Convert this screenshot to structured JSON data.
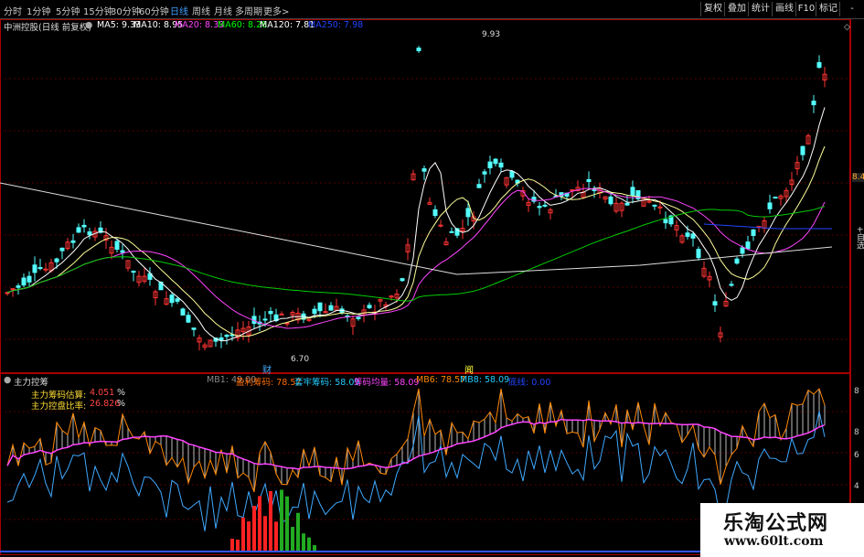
{
  "toolbar": {
    "periods": [
      "分时",
      "1分钟",
      "5分钟",
      "15分钟",
      "30分钟",
      "60分钟",
      "日线",
      "周线",
      "月线",
      "多周期",
      "更多>"
    ],
    "active_period": "日线",
    "buttons": [
      "复权",
      "叠加",
      "统计",
      "画线",
      "F10",
      "标记",
      "-"
    ]
  },
  "main": {
    "title": "中洲控股(日线 前复权)",
    "ma": [
      {
        "label": "MA5: 9.33",
        "color": "#ffffff"
      },
      {
        "label": "MA10: 8.95",
        "color": "#ffffff"
      },
      {
        "label": "MA20: 8.33",
        "color": "#ff44ff"
      },
      {
        "label": "MA60: 8.28",
        "color": "#00ff00"
      },
      {
        "label": "MA120: 7.81",
        "color": "#ffffff"
      },
      {
        "label": "MA250: 7.98",
        "color": "#2244ff"
      }
    ],
    "high_label": "9.93",
    "low_label": "6.70",
    "marker_cai": "财",
    "marker_wen": "闻",
    "price_tag": "8.49",
    "add_self": "+自选"
  },
  "indicator": {
    "title": "主力控筹",
    "items": [
      {
        "label": "MB1: 49.00",
        "color": "#888888"
      },
      {
        "label": "盈利筹码: 78.57",
        "color": "#ff6a00"
      },
      {
        "label": "套牢筹码: 58.09",
        "color": "#22ccff"
      },
      {
        "label": "筹码均量: 58.09",
        "color": "#ff44ff"
      },
      {
        "label": "MB6: 78.57",
        "color": "#ff8800"
      },
      {
        "label": "MB8: 58.09",
        "color": "#22ccff"
      },
      {
        "label": "底线: 0.00",
        "color": "#2244ff"
      }
    ],
    "estimate_label": "主力筹码估算:",
    "estimate_value": "4.051",
    "estimate_unit": "%",
    "ratio_label": "主力控盘比率:",
    "ratio_value": "26.826",
    "ratio_unit": "%",
    "axis_ticks": [
      "8",
      "6",
      "4"
    ]
  },
  "watermark": {
    "title": "乐淘公式网",
    "url": "www.60lt.com"
  }
}
